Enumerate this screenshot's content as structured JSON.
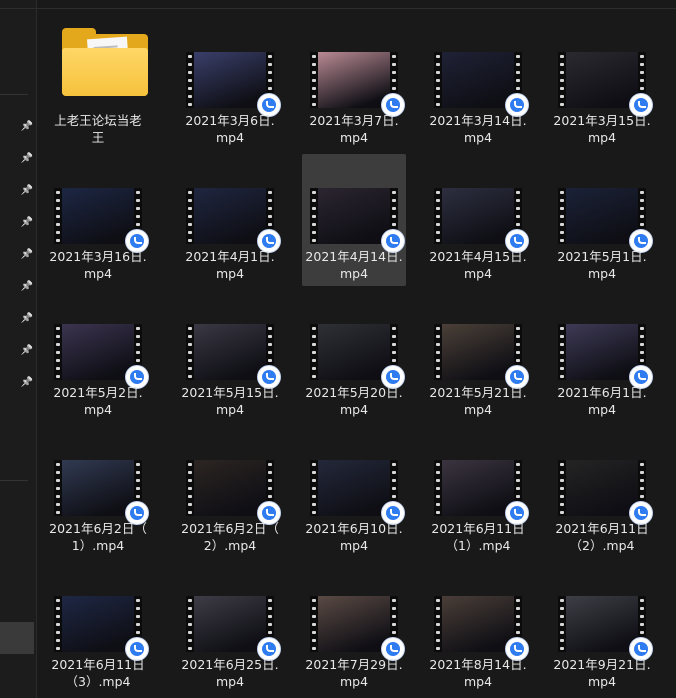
{
  "folder": {
    "label_line1": "上老王论坛当老",
    "label_line2": "王"
  },
  "files": [
    {
      "l1": "2021年3月6日.",
      "l2": "mp4",
      "c": "#3a3f6a"
    },
    {
      "l1": "2021年3月7日.",
      "l2": "mp4",
      "c": "#b98a94"
    },
    {
      "l1": "2021年3月14日.",
      "l2": "mp4",
      "c": "#1f2236"
    },
    {
      "l1": "2021年3月15日.",
      "l2": "mp4",
      "c": "#2a2a30"
    },
    {
      "l1": "2021年3月16日.",
      "l2": "mp4",
      "c": "#1d2744"
    },
    {
      "l1": "2021年4月1日.",
      "l2": "mp4",
      "c": "#1f2640"
    },
    {
      "l1": "2021年4月14日.",
      "l2": "mp4",
      "c": "#2b2530"
    },
    {
      "l1": "2021年4月15日.",
      "l2": "mp4",
      "c": "#2d2f40"
    },
    {
      "l1": "2021年5月1日.",
      "l2": "mp4",
      "c": "#1b2238"
    },
    {
      "l1": "2021年5月2日.",
      "l2": "mp4",
      "c": "#3b3450"
    },
    {
      "l1": "2021年5月15日.",
      "l2": "mp4",
      "c": "#3a3844"
    },
    {
      "l1": "2021年5月20日.",
      "l2": "mp4",
      "c": "#2f3036"
    },
    {
      "l1": "2021年5月21日.",
      "l2": "mp4",
      "c": "#4b4038"
    },
    {
      "l1": "2021年6月1日.",
      "l2": "mp4",
      "c": "#3e3a56"
    },
    {
      "l1": "2021年6月2日（",
      "l2": "1）.mp4",
      "c": "#313a52"
    },
    {
      "l1": "2021年6月2日（",
      "l2": "2）.mp4",
      "c": "#2c2522"
    },
    {
      "l1": "2021年6月10日.",
      "l2": "mp4",
      "c": "#23283a"
    },
    {
      "l1": "2021年6月11日",
      "l2": "（1）.mp4",
      "c": "#3b3440"
    },
    {
      "l1": "2021年6月11日",
      "l2": "（2）.mp4",
      "c": "#242424"
    },
    {
      "l1": "2021年6月11日",
      "l2": "（3）.mp4",
      "c": "#1e2744"
    },
    {
      "l1": "2021年6月25日.",
      "l2": "mp4",
      "c": "#3e3c46"
    },
    {
      "l1": "2021年7月29日.",
      "l2": "mp4",
      "c": "#5a4a44"
    },
    {
      "l1": "2021年8月14日.",
      "l2": "mp4",
      "c": "#4a3e38"
    },
    {
      "l1": "2021年9月21日.",
      "l2": "mp4",
      "c": "#3e3e46"
    }
  ],
  "selected_index": 6,
  "badge_icon": "baidu-netdisk-sync-icon",
  "pin_icon": "pin-icon"
}
